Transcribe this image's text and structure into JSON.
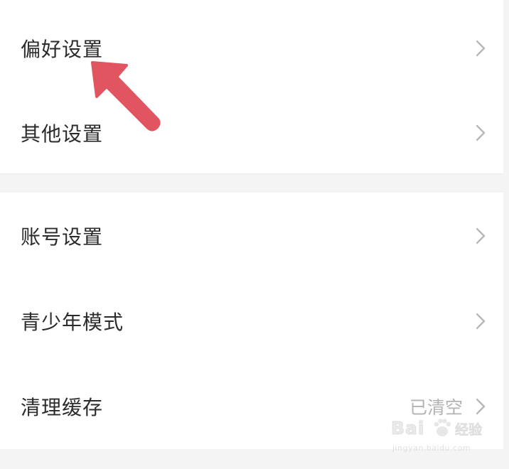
{
  "settings": {
    "group1": [
      {
        "label": "偏好设置",
        "value": ""
      },
      {
        "label": "其他设置",
        "value": ""
      }
    ],
    "group2": [
      {
        "label": "账号设置",
        "value": ""
      },
      {
        "label": "青少年模式",
        "value": ""
      },
      {
        "label": "清理缓存",
        "value": "已清空"
      }
    ]
  },
  "annotation": {
    "pointer_icon": "arrow-pointer-icon",
    "pointer_color": "#e05560"
  },
  "watermark": {
    "brand": "Bai",
    "brand_suffix": "经验",
    "url": "jingyan.baidu.com"
  },
  "colors": {
    "background": "#f4f4f4",
    "card": "#ffffff",
    "label": "#2b2b2b",
    "secondary": "#b3b3b3",
    "chevron": "#b8b8b8"
  }
}
